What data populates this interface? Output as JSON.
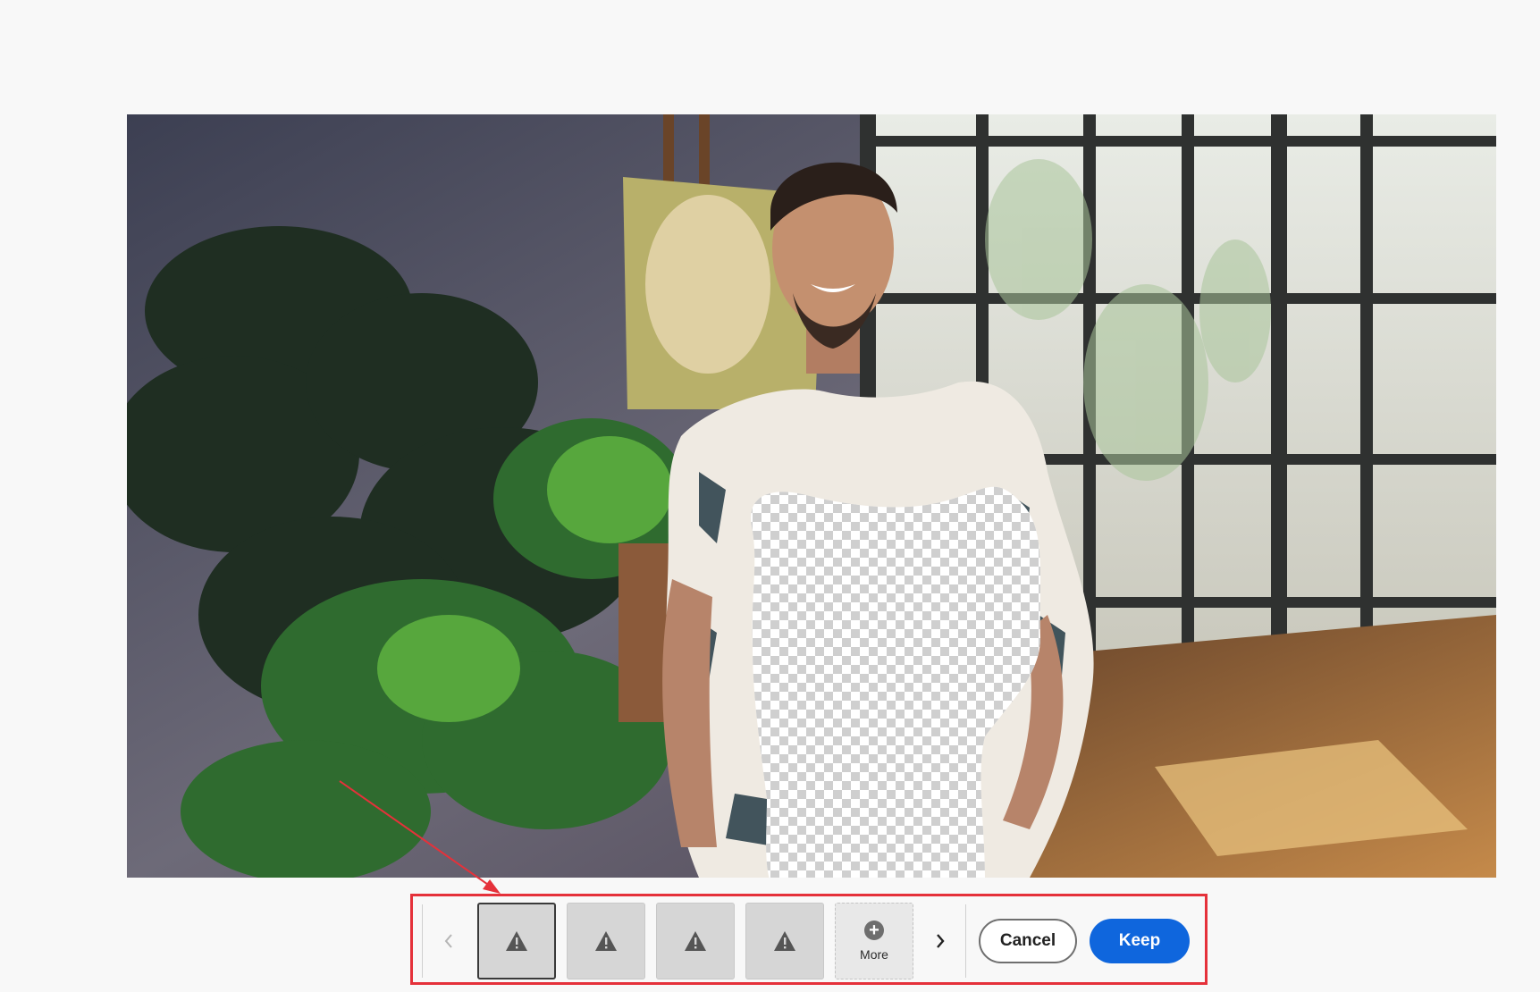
{
  "canvas": {
    "image_name": "photo-man-in-studio-with-plants"
  },
  "variations": {
    "prev_icon": "chevron-left-icon",
    "next_icon": "chevron-right-icon",
    "thumbnails": [
      {
        "icon": "warning-icon",
        "selected": true
      },
      {
        "icon": "warning-icon",
        "selected": false
      },
      {
        "icon": "warning-icon",
        "selected": false
      },
      {
        "icon": "warning-icon",
        "selected": false
      }
    ],
    "more_icon": "plus-circle-icon",
    "more_label": "More"
  },
  "actions": {
    "cancel_label": "Cancel",
    "keep_label": "Keep"
  },
  "colors": {
    "accent": "#0f66dd",
    "annotation": "#e5313a"
  }
}
